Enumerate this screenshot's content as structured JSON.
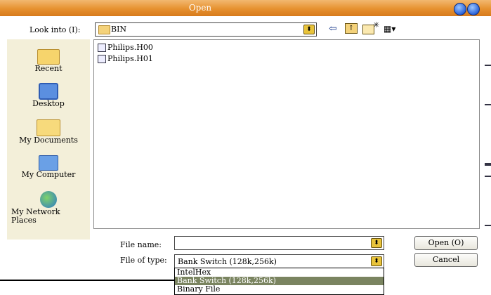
{
  "window": {
    "title": "Open"
  },
  "lookin": {
    "label": "Look into (I):",
    "value": "BIN"
  },
  "places": [
    {
      "label": "Recent"
    },
    {
      "label": "Desktop"
    },
    {
      "label": "My Documents"
    },
    {
      "label": "My Computer"
    },
    {
      "label": "My Network Places"
    }
  ],
  "files": [
    {
      "name": "Philips.H00"
    },
    {
      "name": "Philips.H01"
    }
  ],
  "filename": {
    "label": "File name:",
    "value": ""
  },
  "filetype": {
    "label": "File of type:",
    "value": "Bank Switch (128k,256k)",
    "options": [
      "IntelHex",
      "Bank Switch (128k,256k)",
      "Binary File"
    ]
  },
  "buttons": {
    "open": "Open (O)",
    "cancel": "Cancel"
  },
  "icons": {
    "back": "back-arrow-icon",
    "up": "up-folder-icon",
    "new_folder": "new-folder-icon",
    "view": "view-menu-icon"
  },
  "colors": {
    "titlebar": "#e6912f",
    "places_bg": "#f3efd9",
    "selection": "#7a8460"
  }
}
